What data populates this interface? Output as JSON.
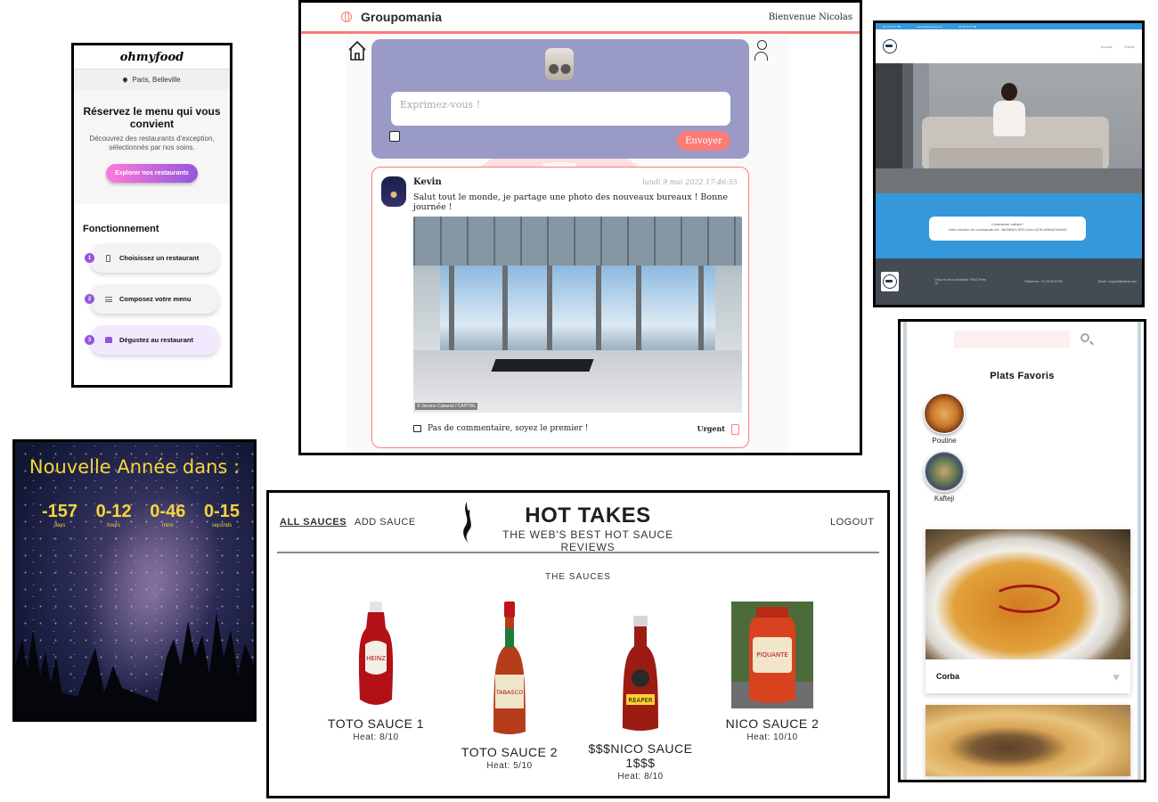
{
  "ohmyfood": {
    "logo": "ohmyfood",
    "location": "Paris, Belleville",
    "hero_title": "Réservez le menu qui vous convient",
    "hero_text": "Découvrez des restaurants d'exception, sélectionnés par nos soins.",
    "hero_button": "Explorer nos restaurants",
    "section_title": "Fonctionnement",
    "steps": [
      {
        "num": "1",
        "label": "Choisissez un restaurant",
        "icon": "phone-icon"
      },
      {
        "num": "2",
        "label": "Composez votre menu",
        "icon": "list-icon"
      },
      {
        "num": "3",
        "label": "Dégustez au restaurant",
        "icon": "store-icon"
      }
    ],
    "accent": "#9356dc"
  },
  "groupomania": {
    "brand": "Groupomania",
    "welcome": "Bienvenue Nicolas",
    "composer_placeholder": "Exprimez-vous !",
    "send_button": "Envoyer",
    "post": {
      "author": "Kevin",
      "date": "lundi 9 mai 2022 17:46:55",
      "text": "Salut tout le monde, je partage une photo des nouveaux bureaux ! Bonne journée !",
      "photo_credit": "© Jerome Cabanel / CAPITAL",
      "comments": "Pas de commentaire, soyez le premier !",
      "urgent_label": "Urgent"
    },
    "accent": "#fd7b77",
    "composer_color": "#9a9ac6"
  },
  "order": {
    "top_bar": [
      "01 23 45 67 89",
      "support@eternity.com",
      "01 23 45 67 89"
    ],
    "nav": [
      "Accueil",
      "Panier"
    ],
    "message_line1": "Commande validée !",
    "message_line2": "Votre numéro de commande est : 8e2f8420-9f7b-11ec-b276-ef9bd27eeb43",
    "footer": {
      "address": "Cinq rue de la chaussée 75010 Paris 10",
      "phone": "Téléphone : 01 23 45 67 89",
      "email": "Email : support@name.com"
    },
    "accent": "#3498db"
  },
  "countdown": {
    "title": "Nouvelle Année dans :",
    "units": [
      {
        "value": "-157",
        "label": "days"
      },
      {
        "value": "0-12",
        "label": "hours"
      },
      {
        "value": "0-46",
        "label": "mins"
      },
      {
        "value": "0-15",
        "label": "seconds"
      }
    ],
    "accent": "#f4d53a"
  },
  "hottakes": {
    "nav_all": "ALL SAUCES",
    "nav_add": "ADD SAUCE",
    "title": "HOT TAKES",
    "subtitle": "THE WEB'S BEST HOT SAUCE REVIEWS",
    "logout": "LOGOUT",
    "section": "THE SAUCES",
    "sauces": [
      {
        "name": "TOTO SAUCE 1",
        "heat": "Heat: 8/10"
      },
      {
        "name": "TOTO SAUCE 2",
        "heat": "Heat: 5/10"
      },
      {
        "name": "$$$NICO SAUCE 1$$$",
        "heat": "Heat: 8/10"
      },
      {
        "name": "NICO SAUCE 2",
        "heat": "Heat: 10/10"
      }
    ]
  },
  "plats": {
    "title": "Plats Favoris",
    "favorites": [
      "Poutine",
      "Kafteji"
    ],
    "cards": [
      "Corba"
    ],
    "search_icon": "search-icon",
    "heart_icon": "heart-icon"
  }
}
